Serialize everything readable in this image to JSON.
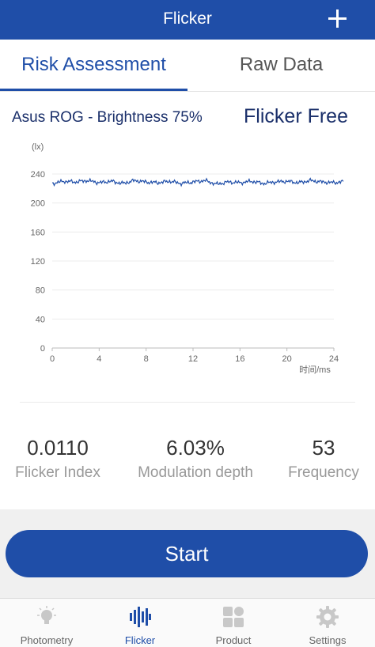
{
  "navbar": {
    "title": "Flicker",
    "add_icon": "plus-icon"
  },
  "tabs": [
    {
      "label": "Risk Assessment",
      "active": true
    },
    {
      "label": "Raw Data",
      "active": false
    }
  ],
  "measurement": {
    "device": "Asus ROG - Brightness 75%",
    "verdict": "Flicker Free"
  },
  "chart_data": {
    "type": "line",
    "ylabel": "(lx)",
    "xlabel": "时间/ms",
    "xlim": [
      0,
      24
    ],
    "ylim": [
      0,
      240
    ],
    "xticks": [
      "0",
      "4",
      "8",
      "12",
      "16",
      "20",
      "24"
    ],
    "yticks": [
      "0",
      "40",
      "80",
      "120",
      "160",
      "200",
      "240"
    ],
    "grid": true,
    "series": [
      {
        "color": "#1f4ea8",
        "x": [
          0,
          1,
          2,
          3,
          4,
          5,
          6,
          7,
          8,
          9,
          10,
          11,
          12,
          13,
          14,
          15,
          16,
          17,
          18,
          19,
          20,
          21,
          22,
          23,
          24,
          25
        ],
        "y": [
          227,
          230,
          229,
          231,
          228,
          230,
          227,
          231,
          229,
          228,
          230,
          227,
          229,
          231,
          226,
          229,
          228,
          230,
          227,
          229,
          230,
          228,
          231,
          229,
          228,
          230
        ]
      }
    ]
  },
  "metrics": [
    {
      "value": "0.0110",
      "label": "Flicker Index"
    },
    {
      "value": "6.03%",
      "label": "Modulation depth"
    },
    {
      "value": "53",
      "label": "Frequency"
    }
  ],
  "start_button": {
    "label": "Start"
  },
  "tabbar": [
    {
      "label": "Photometry",
      "icon": "lightbulb-icon",
      "active": false
    },
    {
      "label": "Flicker",
      "icon": "waveform-icon",
      "active": true
    },
    {
      "label": "Product",
      "icon": "grid-icon",
      "active": false
    },
    {
      "label": "Settings",
      "icon": "gear-icon",
      "active": false
    }
  ],
  "colors": {
    "primary": "#1f4ea8",
    "inactive_icon": "#c8c8c8"
  }
}
